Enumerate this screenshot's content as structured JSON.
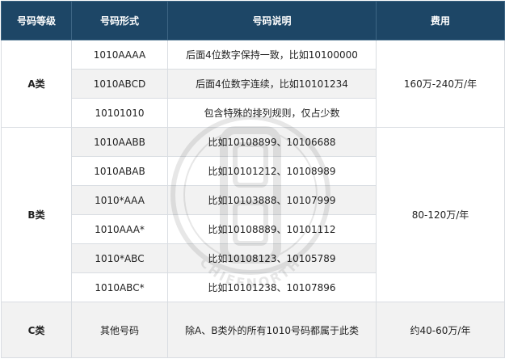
{
  "headers": {
    "grade": "号码等级",
    "format": "号码形式",
    "description": "号码说明",
    "fee": "费用"
  },
  "groups": [
    {
      "grade": "A类",
      "fee": "160万-240万/年",
      "rows": [
        {
          "format": "1010AAAA",
          "description": "后面4位数字保持一致，比如10100000"
        },
        {
          "format": "1010ABCD",
          "description": "后面4位数字连续，比如10101234"
        },
        {
          "format": "10101010",
          "description": "包含特殊的排列规则，仅占少数"
        }
      ]
    },
    {
      "grade": "B类",
      "fee": "80-120万/年",
      "rows": [
        {
          "format": "1010AABB",
          "description": "比如10108899、10106688"
        },
        {
          "format": "1010ABAB",
          "description": "比如10101212、10108989"
        },
        {
          "format": "1010*AAA",
          "description": "比如10103888、10107999"
        },
        {
          "format": "1010AAA*",
          "description": "比如10108889、10101112"
        },
        {
          "format": "1010*ABC",
          "description": "比如10108123、10105789"
        },
        {
          "format": "1010ABC*",
          "description": "比如10101238、10107896"
        }
      ]
    },
    {
      "grade": "C类",
      "fee": "约40-60万/年",
      "rows": [
        {
          "format": "其他号码",
          "description": "除A、B类外的所有1010号码都属于此类"
        }
      ]
    }
  ],
  "watermark_text": "CHIEFNORTH"
}
